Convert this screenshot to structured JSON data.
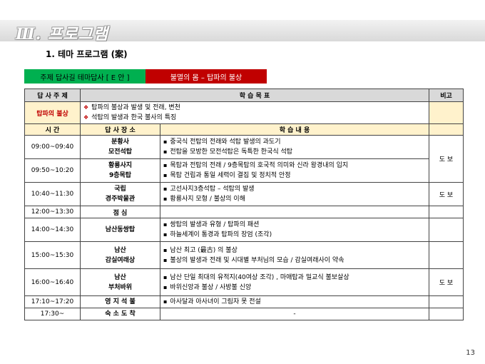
{
  "header": {
    "title": "Ⅲ. 프로그램"
  },
  "subtitle": "1. 테마 프로그램 (案)",
  "theme": {
    "label": "주제 답사길 테마답사 [ E 안 ]",
    "value": "불멸의 몸 – 탑파의 불상"
  },
  "table": {
    "headers": {
      "topic": "답 사 주 제",
      "goals": "학 습 목 표",
      "notes": "비고"
    },
    "topic_row": {
      "label": "탑파의 불상",
      "goals": [
        "탑파의 불상과 발생 및 전래, 변천",
        "석탑의 발생과 한국 불사의 특징"
      ]
    },
    "subheaders": {
      "time": "시 간",
      "place": "답 사 장 소",
      "content": "학 습 내 용"
    },
    "rows": [
      {
        "time": "09:00~09:40",
        "place": [
          "분황사",
          "모전석탑"
        ],
        "items": [
          "중국식 전탑의 전래와 석탑 발생의 과도기",
          "전탑을 모방한 모전석탑은 독특한 한국식 석탑"
        ],
        "note": ""
      },
      {
        "time": "09:50~10:20",
        "place": [
          "황룡사지",
          "9층목탑"
        ],
        "items": [
          "목탑과 전탑의 전래 / 9층목탑의 호국적 의미와 신라 왕경내의 입지",
          "목탑 건립과 통일 세력이 결집 및 정치적 안정"
        ],
        "note": "도 보"
      },
      {
        "time": "10:40~11:30",
        "place": [
          "국립",
          "경주박물관"
        ],
        "items": [
          "고선사지3층석탑 – 석탑의 발생",
          "황룡사지 모형 / 불상의 이해"
        ],
        "note": "도 보"
      },
      {
        "time": "12:00~13:30",
        "place": [
          "점 심"
        ],
        "items": [],
        "note": ""
      },
      {
        "time": "14:00~14:30",
        "place": [
          "남산동쌍탑"
        ],
        "items": [
          "쌍탑의 발생과 유형 / 탑파의 패션",
          "하늘세계이 통경과 탑파의 장엄 (조각)"
        ],
        "note": ""
      },
      {
        "time": "15:00~15:30",
        "place": [
          "남산",
          "감실여래상"
        ],
        "items": [
          "남산 최고 (最古) 의 불상",
          "불상의 발생과 전래 및 시대별 부처님의 모습 / 감실여래사이 약속"
        ],
        "note": ""
      },
      {
        "time": "16:00~16:40",
        "place": [
          "남산",
          "부처바위"
        ],
        "items": [
          "남산 단일 최대의 유적지(40여상 조각) , 마애탑과 밀교식 불보살상",
          "바위신앙과 불상 / 사방불 신앙"
        ],
        "note": "도 보"
      },
      {
        "time": "17:10~17:20",
        "place": [
          "영 지 석 불"
        ],
        "items": [
          "아사달과 아사녀이 그림자 못 전설"
        ],
        "note": ""
      },
      {
        "time": "17:30~",
        "place": [
          "숙 소 도 착"
        ],
        "items": [],
        "center_text": "-",
        "note": ""
      }
    ]
  },
  "page_number": "13"
}
